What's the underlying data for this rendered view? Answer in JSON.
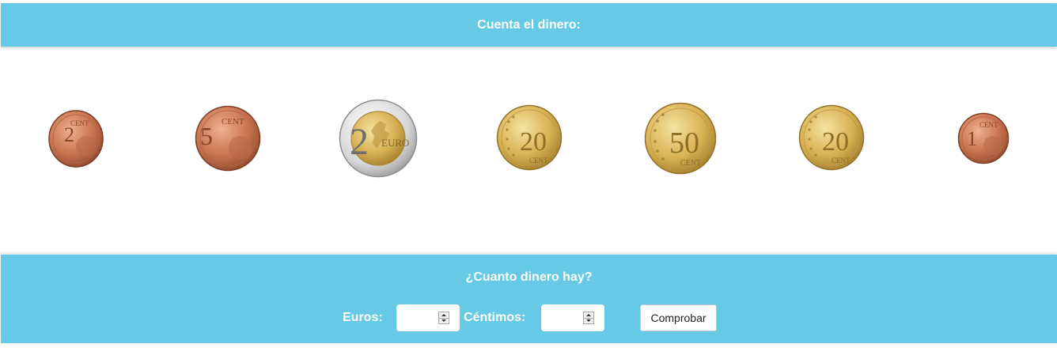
{
  "header": {
    "title": "Cuenta el dinero:"
  },
  "coins": [
    {
      "denomination": "2 cent",
      "value_cents": 2,
      "numeral": "2",
      "unit": "CENT",
      "type": "copper"
    },
    {
      "denomination": "5 cent",
      "value_cents": 5,
      "numeral": "5",
      "unit": "CENT",
      "type": "copper"
    },
    {
      "denomination": "2 euro",
      "value_cents": 200,
      "numeral": "2",
      "unit": "EURO",
      "type": "bimetal"
    },
    {
      "denomination": "20 cent",
      "value_cents": 20,
      "numeral": "20",
      "unit": "CENT",
      "type": "gold"
    },
    {
      "denomination": "50 cent",
      "value_cents": 50,
      "numeral": "50",
      "unit": "CENT",
      "type": "gold"
    },
    {
      "denomination": "20 cent",
      "value_cents": 20,
      "numeral": "20",
      "unit": "CENT",
      "type": "gold"
    },
    {
      "denomination": "1 cent",
      "value_cents": 1,
      "numeral": "1",
      "unit": "CENT",
      "type": "copper"
    }
  ],
  "answer": {
    "question": "¿Cuanto dinero hay?",
    "euros_label": "Euros:",
    "euros_value": "",
    "cents_label": "Céntimos:",
    "cents_value": "",
    "check_label": "Comprobar"
  },
  "colors": {
    "band": "#66cae6",
    "copper": "#c8734f",
    "gold": "#d9b254",
    "silver": "#d6d6d6"
  }
}
